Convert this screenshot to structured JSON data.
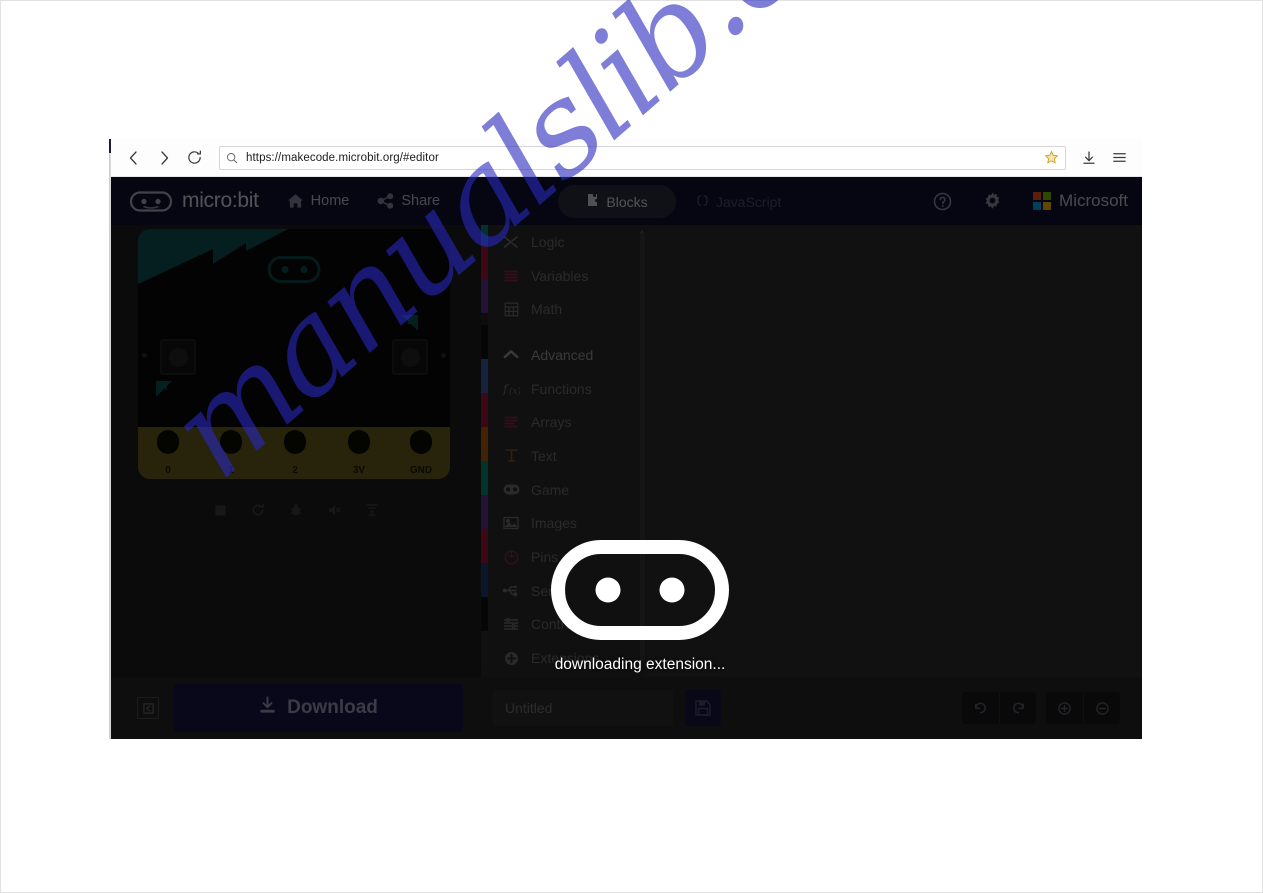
{
  "browser": {
    "url": "https://makecode.microbit.org/#editor",
    "back_label": "Back",
    "forward_label": "Forward",
    "reload_label": "Reload",
    "bookmark_label": "Bookmark",
    "downloads_label": "Downloads",
    "menu_label": "Menu"
  },
  "header": {
    "brand": "micro:bit",
    "home_label": "Home",
    "share_label": "Share",
    "tabs": [
      {
        "label": "Blocks",
        "active": true
      },
      {
        "label": "JavaScript",
        "active": false
      }
    ],
    "help_label": "Help",
    "settings_label": "Settings",
    "microsoft_label": "Microsoft"
  },
  "simulator": {
    "pin_labels": [
      "0",
      "1",
      "2",
      "3V",
      "GND"
    ],
    "button_a_label": "A",
    "button_b_label": "B",
    "controls": [
      "stop-icon",
      "restart-icon",
      "debug-icon",
      "mute-icon",
      "fullscreen-icon"
    ]
  },
  "toolbox": {
    "items": [
      {
        "label": "Logic",
        "color": "#00876e",
        "icon": "logic-icon"
      },
      {
        "label": "Variables",
        "color": "#a0133a",
        "icon": "variables-icon"
      },
      {
        "label": "Math",
        "color": "#5c2d91",
        "icon": "math-icon"
      },
      {
        "label": "Advanced",
        "color": "#1f1f1f",
        "icon": "chevron-up-icon"
      },
      {
        "label": "Functions",
        "color": "#3b5aa8",
        "icon": "functions-icon"
      },
      {
        "label": "Arrays",
        "color": "#a0133a",
        "icon": "arrays-icon"
      },
      {
        "label": "Text",
        "color": "#b1580a",
        "icon": "text-icon"
      },
      {
        "label": "Game",
        "color": "#00876e",
        "icon": "game-icon"
      },
      {
        "label": "Images",
        "color": "#5c2d91",
        "icon": "images-icon"
      },
      {
        "label": "Pins",
        "color": "#a0133a",
        "icon": "pins-icon"
      },
      {
        "label": "Serial",
        "color": "#1f3b78",
        "icon": "serial-icon"
      },
      {
        "label": "Control",
        "color": "#1a1a1a",
        "icon": "control-icon"
      },
      {
        "label": "Extensions",
        "color": "#333333",
        "icon": "extensions-icon"
      }
    ]
  },
  "bottom": {
    "collapse_label": "Collapse simulator",
    "download_label": "Download",
    "project_name_value": "",
    "project_name_placeholder": "Untitled",
    "save_label": "Save",
    "undo_label": "Undo",
    "redo_label": "Redo",
    "zoom_in_label": "Zoom in",
    "zoom_out_label": "Zoom out"
  },
  "loading": {
    "message": "downloading extension...",
    "logo_name": "microbit-logo"
  },
  "watermark": {
    "text": "manualslib.com"
  },
  "colors": {
    "header_bg": "#0e1130",
    "app_bg": "#2d2d2d",
    "toolbox_bg": "#2b2b2b",
    "download_bg": "#171744",
    "watermark": "#2828be"
  }
}
